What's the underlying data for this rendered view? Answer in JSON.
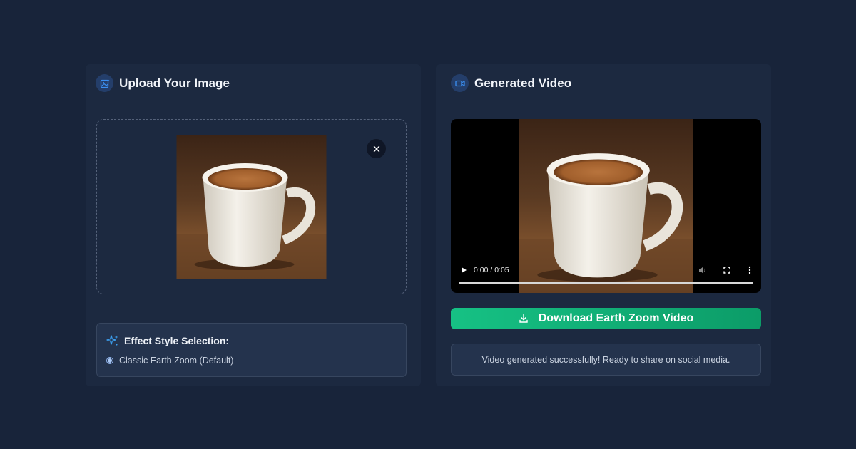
{
  "upload_panel": {
    "title": "Upload Your Image",
    "icon": "image-sparkle-icon",
    "remove_icon": "close-icon"
  },
  "effect_style": {
    "title": "Effect Style Selection:",
    "icon": "sparkles-icon",
    "options": [
      {
        "label": "Classic Earth Zoom (Default)",
        "selected": true
      }
    ]
  },
  "video_panel": {
    "title": "Generated Video",
    "icon": "video-camera-icon",
    "player": {
      "time": "0:00 / 0:05",
      "progress": 0
    }
  },
  "download_button": {
    "label": "Download Earth Zoom Video",
    "icon": "download-icon"
  },
  "status": {
    "message": "Video generated successfully! Ready to share on social media."
  },
  "colors": {
    "background": "#18243a",
    "panel": "#1c2940",
    "accent_blue": "#3b8ff0",
    "success_green": "#16c184"
  }
}
